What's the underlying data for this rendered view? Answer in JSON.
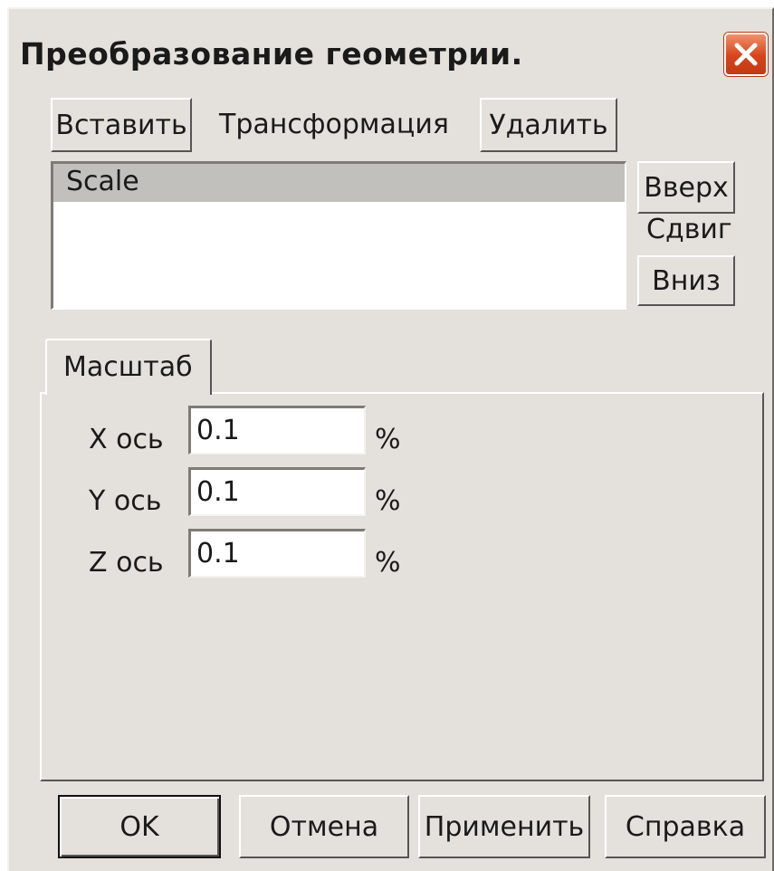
{
  "window": {
    "title": "Преобразование геометрии."
  },
  "toolbar": {
    "insert_label": "Вставить",
    "transform_label": "Трансформация",
    "delete_label": "Удалить"
  },
  "transform_list": {
    "items": [
      "Scale"
    ],
    "selected": "Scale"
  },
  "shift": {
    "up_label": "Вверх",
    "shift_label": "Сдвиг",
    "down_label": "Вниз"
  },
  "tabs": [
    {
      "label": "Масштаб",
      "active": true
    }
  ],
  "scale": {
    "x_label": "X ось",
    "x_value": "0.1",
    "y_label": "Y ось",
    "y_value": "0.1",
    "z_label": "Z ось",
    "z_value": "0.1",
    "unit": "%"
  },
  "footer": {
    "ok_label": "OK",
    "cancel_label": "Отмена",
    "apply_label": "Применить",
    "help_label": "Справка"
  },
  "colors": {
    "dialog_bg": "#e4e1dc",
    "selection_bg": "#c2c0bc",
    "close_button": "#d8431a"
  },
  "icons": {
    "close": "close-icon"
  }
}
